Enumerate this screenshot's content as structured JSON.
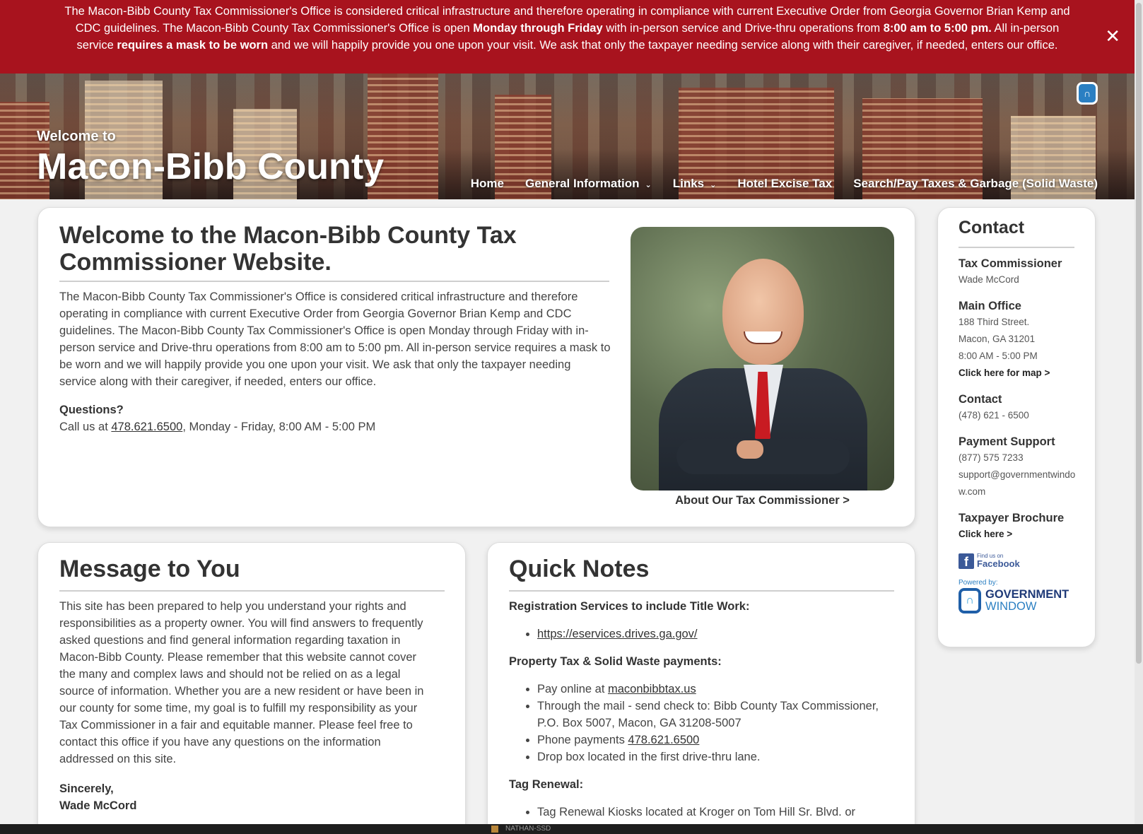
{
  "alert": {
    "t1": "The Macon-Bibb County Tax Commissioner's Office is considered critical infrastructure and therefore operating in compliance with current Executive Order from Georgia Governor Brian Kemp and CDC guidelines. The Macon-Bibb County Tax Commissioner's Office is open ",
    "b1": "Monday through Friday",
    "t2": " with in-person service and Drive-thru operations from ",
    "b2": "8:00 am to 5:00 pm.",
    "t3": " All in-person service ",
    "b3": "requires a mask to be worn",
    "t4": " and we will happily provide you one upon your visit. We ask that only the taxpayer needing service along with their caregiver, if needed, enters our office.",
    "close": "✕"
  },
  "header": {
    "welcome": "Welcome to",
    "title": "Macon-Bibb County",
    "gw_icon": "government-window-icon"
  },
  "nav": {
    "home": "Home",
    "general": "General Information",
    "links": "Links",
    "hotel": "Hotel Excise Tax",
    "search": "Search/Pay Taxes & Garbage (Solid Waste)",
    "chevron": "⌄"
  },
  "welcome": {
    "heading": "Welcome to the Macon-Bibb County Tax Commissioner Website.",
    "paragraph": "The Macon-Bibb County Tax Commissioner's Office is considered critical infrastructure and therefore operating in compliance with current Executive Order from Georgia Governor Brian Kemp and CDC guidelines. The Macon-Bibb County Tax Commissioner's Office is open Monday through Friday with in-person service and Drive-thru operations from 8:00 am to 5:00 pm. All in-person service requires a mask to be worn and we will happily provide you one upon your visit. We ask that only the taxpayer needing service along with their caregiver, if needed, enters our office.",
    "questions": "Questions?",
    "call_prefix": "Call us at ",
    "phone": "478.621.6500",
    "call_suffix": ", Monday - Friday, 8:00 AM - 5:00 PM",
    "about_link": "About Our Tax Commissioner >"
  },
  "message": {
    "heading": "Message to You",
    "paragraph": "This site has been prepared to help you understand your rights and responsibilities as a property owner. You will find answers to frequently asked questions and find general information regarding taxation in Macon-Bibb County. Please remember that this website cannot cover the many and complex laws and should not be relied on as a legal source of information. Whether you are a new resident or have been in our county for some time, my goal is to fulfill my responsibility as your Tax Commissioner in a fair and equitable manner. Please feel free to contact this office if you have any questions on the information addressed on this site.",
    "sincerely": "Sincerely,",
    "signature": "Wade McCord"
  },
  "notes": {
    "heading": "Quick Notes",
    "reg_label": "Registration Services to include Title Work:",
    "reg_link": "https://eservices.drives.ga.gov/",
    "prop_label": "Property Tax & Solid Waste payments:",
    "pay_online_prefix": "Pay online at ",
    "pay_online_link": "maconbibbtax.us",
    "mail": "Through the mail - send check to: Bibb County Tax Commissioner, P.O. Box 5007, Macon, GA 31208-5007",
    "phone_prefix": "Phone payments ",
    "phone_link": "478.621.6500",
    "dropbox": "Drop box located in the first drive-thru lane.",
    "tag_label": "Tag Renewal:",
    "tag_item": "Tag Renewal Kiosks located at Kroger on Tom Hill Sr. Blvd. or"
  },
  "contact": {
    "title": "Contact",
    "tc_head": "Tax Commissioner",
    "tc_name": "Wade McCord",
    "office_head": "Main Office",
    "office_addr1": "188 Third Street.",
    "office_addr2": "Macon, GA 31201",
    "office_hours": "8:00 AM - 5:00 PM",
    "map_link": "Click here for map >",
    "contact_head": "Contact",
    "contact_phone": "(478) 621 - 6500",
    "support_head": "Payment Support",
    "support_phone": "(877) 575 7233",
    "support_email": "support@governmentwindow.com",
    "brochure_head": "Taxpayer Brochure",
    "brochure_link": "Click here >",
    "fb_small": "Find us on",
    "fb_big": "Facebook",
    "gw_powered": "Powered by:",
    "gw_name1": "GOVERNMENT",
    "gw_name2": "WINDOW"
  },
  "taskbar": {
    "label": "NATHAN-SSD"
  },
  "colors": {
    "alert_bg": "#a8131e",
    "text": "#333333",
    "facebook": "#3b5998",
    "gw_blue": "#2b7fc2"
  }
}
